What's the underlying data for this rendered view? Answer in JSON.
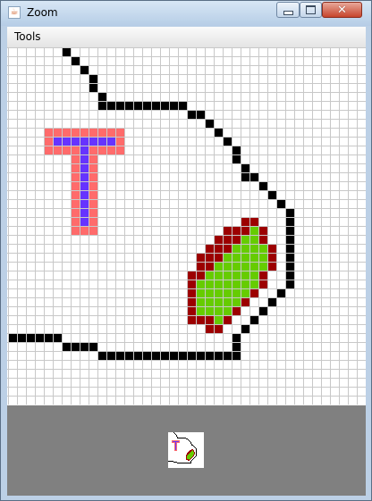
{
  "window": {
    "title": "Zoom",
    "controls": {
      "minimize_label": "",
      "maximize_label": "",
      "close_label": "✕"
    }
  },
  "menu": {
    "items": [
      "Tools"
    ]
  },
  "canvas": {
    "cols": 40,
    "rows": 40,
    "grid_color": "#c8c8c8",
    "colors": {
      "black": "#000000",
      "salmon": "#ff6b6b",
      "purple": "#6633ff",
      "darkred": "#9c0000",
      "green": "#66cc00"
    },
    "layers": [
      {
        "name": "black-outline",
        "color": "black",
        "runs": [
          [
            0,
            6,
            6
          ],
          [
            1,
            7,
            7
          ],
          [
            2,
            8,
            8
          ],
          [
            3,
            9,
            9
          ],
          [
            4,
            9,
            9
          ],
          [
            5,
            10,
            10
          ],
          [
            6,
            10,
            19
          ],
          [
            7,
            20,
            21
          ],
          [
            8,
            22,
            22
          ],
          [
            9,
            23,
            23
          ],
          [
            10,
            24,
            24
          ],
          [
            11,
            25,
            25
          ],
          [
            12,
            25,
            25
          ],
          [
            13,
            26,
            26
          ],
          [
            14,
            26,
            27
          ],
          [
            15,
            28,
            28
          ],
          [
            16,
            29,
            29
          ],
          [
            17,
            30,
            30
          ],
          [
            18,
            31,
            31
          ],
          [
            19,
            31,
            31
          ],
          [
            20,
            31,
            31
          ],
          [
            21,
            31,
            31
          ],
          [
            22,
            31,
            31
          ],
          [
            23,
            31,
            31
          ],
          [
            24,
            31,
            31
          ],
          [
            25,
            31,
            31
          ],
          [
            26,
            31,
            31
          ],
          [
            27,
            30,
            30
          ],
          [
            28,
            29,
            29
          ],
          [
            29,
            28,
            28
          ],
          [
            30,
            27,
            27
          ],
          [
            31,
            26,
            26
          ],
          [
            32,
            0,
            5
          ],
          [
            32,
            25,
            25
          ],
          [
            33,
            6,
            9
          ],
          [
            33,
            25,
            25
          ],
          [
            34,
            10,
            25
          ]
        ]
      },
      {
        "name": "t-glyph-shadow",
        "color": "salmon",
        "runs": [
          [
            9,
            4,
            12
          ],
          [
            10,
            4,
            4
          ],
          [
            10,
            12,
            12
          ],
          [
            11,
            4,
            12
          ],
          [
            12,
            7,
            9
          ],
          [
            13,
            7,
            9
          ],
          [
            14,
            7,
            9
          ],
          [
            15,
            7,
            9
          ],
          [
            16,
            7,
            9
          ],
          [
            17,
            7,
            9
          ],
          [
            18,
            7,
            9
          ],
          [
            19,
            7,
            9
          ],
          [
            20,
            7,
            9
          ]
        ]
      },
      {
        "name": "t-glyph",
        "color": "purple",
        "runs": [
          [
            10,
            5,
            11
          ],
          [
            11,
            8,
            8
          ],
          [
            12,
            8,
            8
          ],
          [
            13,
            8,
            8
          ],
          [
            14,
            8,
            8
          ],
          [
            15,
            8,
            8
          ],
          [
            16,
            8,
            8
          ],
          [
            17,
            8,
            8
          ],
          [
            18,
            8,
            8
          ],
          [
            19,
            8,
            8
          ]
        ]
      },
      {
        "name": "leaf-outline",
        "color": "darkred",
        "runs": [
          [
            19,
            26,
            27
          ],
          [
            20,
            24,
            28
          ],
          [
            21,
            23,
            28
          ],
          [
            22,
            22,
            29
          ],
          [
            23,
            21,
            23
          ],
          [
            23,
            29,
            29
          ],
          [
            24,
            21,
            22
          ],
          [
            24,
            29,
            29
          ],
          [
            25,
            20,
            21
          ],
          [
            25,
            28,
            28
          ],
          [
            26,
            20,
            20
          ],
          [
            26,
            28,
            28
          ],
          [
            27,
            20,
            20
          ],
          [
            27,
            27,
            27
          ],
          [
            28,
            20,
            20
          ],
          [
            28,
            26,
            26
          ],
          [
            29,
            20,
            20
          ],
          [
            29,
            25,
            25
          ],
          [
            30,
            20,
            22
          ],
          [
            30,
            24,
            24
          ],
          [
            31,
            22,
            23
          ]
        ]
      },
      {
        "name": "leaf-fill",
        "color": "green",
        "runs": [
          [
            20,
            27,
            27
          ],
          [
            21,
            26,
            27
          ],
          [
            22,
            25,
            28
          ],
          [
            23,
            24,
            28
          ],
          [
            24,
            23,
            28
          ],
          [
            25,
            22,
            27
          ],
          [
            26,
            21,
            27
          ],
          [
            27,
            21,
            26
          ],
          [
            28,
            21,
            25
          ],
          [
            29,
            21,
            24
          ],
          [
            30,
            23,
            23
          ]
        ]
      }
    ]
  }
}
